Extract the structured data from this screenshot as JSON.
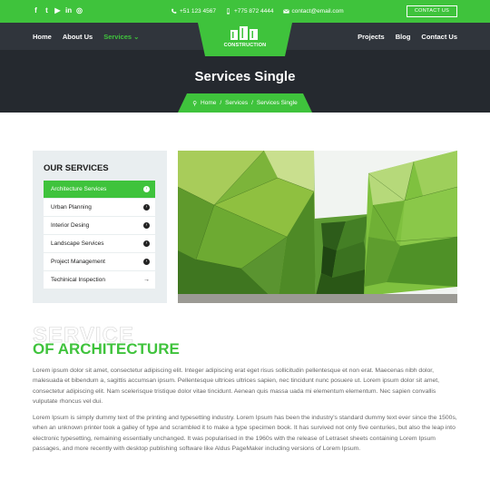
{
  "topbar": {
    "social_icons": [
      "facebook-icon",
      "twitter-icon",
      "youtube-icon",
      "linkedin-icon",
      "instagram-icon"
    ],
    "phone1": "+51 123 4567",
    "phone2": "+775 872 4444",
    "email": "contact@email.com",
    "contact_button": "CONTACT US"
  },
  "nav": {
    "home": "Home",
    "about": "About Us",
    "services": "Services",
    "projects": "Projects",
    "blog": "Blog",
    "contact": "Contact Us",
    "logo_text": "CONSTRUCTION"
  },
  "hero": {
    "title": "Services Single",
    "breadcrumb": [
      "Home",
      "Services",
      "Services Single"
    ]
  },
  "sidebar": {
    "title": "OUR SERVICES",
    "items": [
      {
        "label": "Architecture Services"
      },
      {
        "label": "Urban Planning"
      },
      {
        "label": "Interior Desing"
      },
      {
        "label": "Landscape Services"
      },
      {
        "label": "Project Management"
      },
      {
        "label": "Techinical Inspection"
      }
    ]
  },
  "content": {
    "ghost_heading": "SERVICE",
    "heading": "OF ARCHITECTURE",
    "paragraph1": "Lorem ipsum dolor sit amet, consectetur adipiscing elit. Integer adipiscing erat eget risus sollicitudin pellentesque et non erat. Maecenas nibh dolor, malesuada et bibendum a, sagittis accumsan ipsum. Pellentesque ultrices ultrices sapien, nec tincidunt nunc posuere ut. Lorem ipsum dolor sit amet, consectetur adipiscing elit. Nam scelerisque tristique dolor vitae tincidunt. Aenean quis massa uada mi elementum elementum. Nec sapien convallis vulputate rhoncus vel dui.",
    "paragraph2": "Lorem Ipsum is simply dummy text of the printing and typesetting industry. Lorem Ipsum has been the industry's standard dummy text ever since the 1500s, when an unknown printer took a galley of type and scrambled it to make a type specimen book. It has survived not only five centuries, but also the leap into electronic typesetting, remaining essentially unchanged. It was popularised in the 1960s with the release of Letraset sheets containing Lorem Ipsum passages, and more recently with desktop publishing software like Aldus PageMaker including versions of Lorem Ipsum."
  },
  "colors": {
    "accent": "#3fc33c",
    "dark": "#25292f",
    "sidebar_bg": "#e9eef0"
  }
}
